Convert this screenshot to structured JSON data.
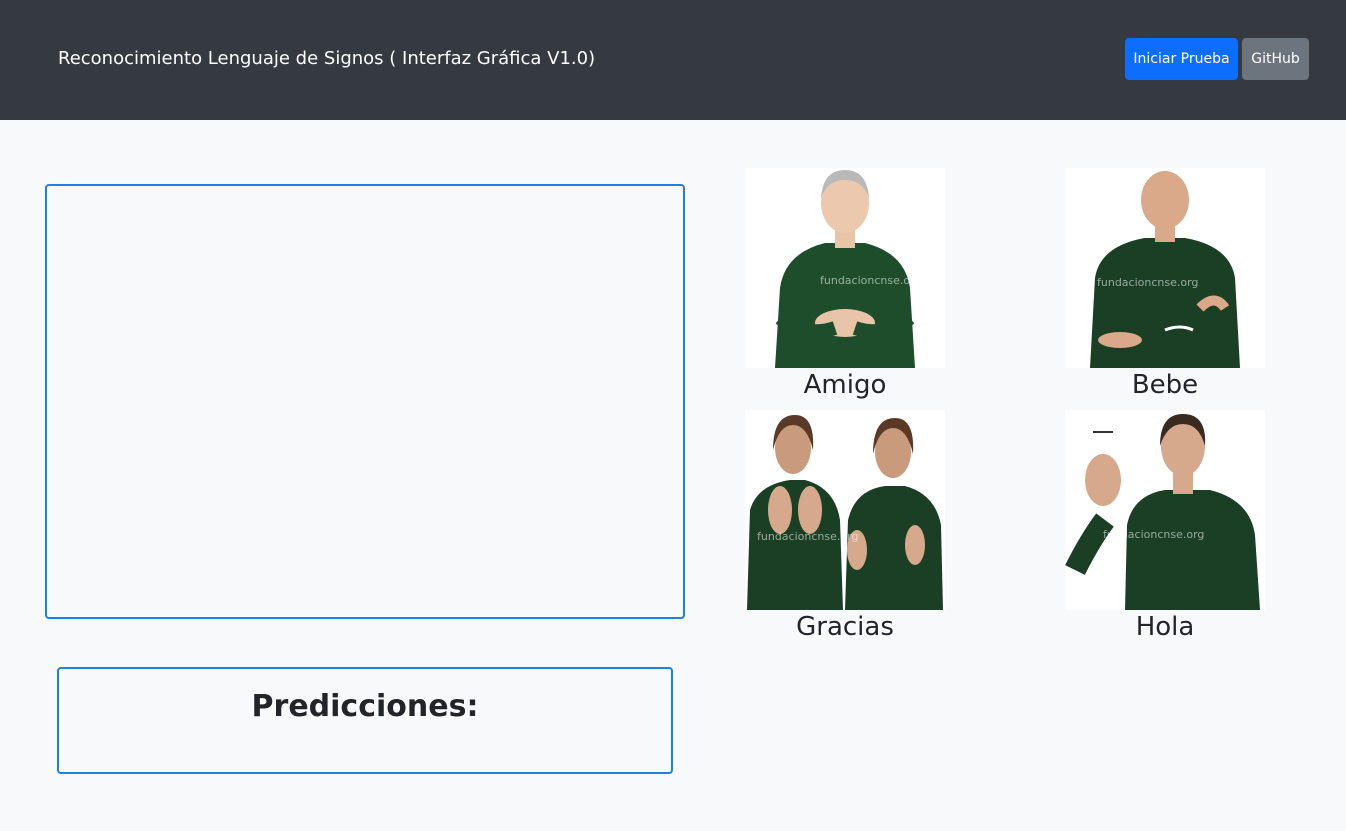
{
  "header": {
    "title": "Reconocimiento Lenguaje de Signos ( Interfaz Gráfica V1.0)",
    "start_button": "Iniciar Prueba",
    "github_button": "GitHub"
  },
  "predictions": {
    "title": "Predicciones:"
  },
  "signs": [
    {
      "label": "Amigo",
      "watermark": "fundacioncnse.org"
    },
    {
      "label": "Bebe",
      "watermark": "fundacioncnse.org"
    },
    {
      "label": "Gracias",
      "watermark": "fundacioncnse.org"
    },
    {
      "label": "Hola",
      "watermark": "fundacioncnse.org"
    }
  ],
  "colors": {
    "navbar": "#343a40",
    "primary": "#0d6efd",
    "secondary": "#6c757d",
    "border_accent": "#1a82e2",
    "sweater": "#1e4d2b"
  }
}
